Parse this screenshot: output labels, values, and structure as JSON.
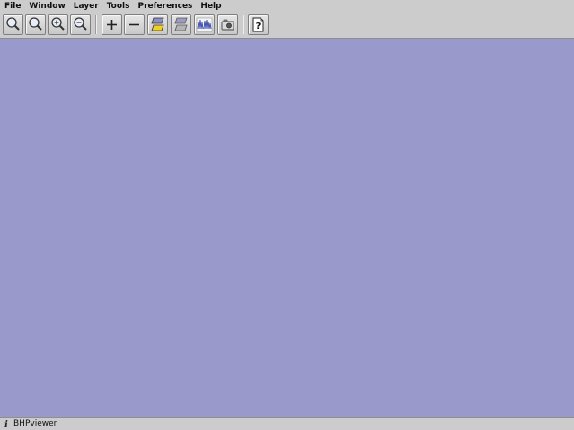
{
  "menu": {
    "items": [
      "File",
      "Window",
      "Layer",
      "Tools",
      "Preferences",
      "Help"
    ]
  },
  "toolbar": {
    "buttons": [
      {
        "name": "zoom-all-button",
        "icon": "magnifier-all-icon"
      },
      {
        "name": "zoom-button",
        "icon": "magnifier-icon"
      },
      {
        "name": "zoom-in-button",
        "icon": "magnifier-plus-icon"
      },
      {
        "name": "zoom-out-button",
        "icon": "magnifier-minus-icon"
      },
      {
        "name": "add-layer-button",
        "icon": "plus-icon"
      },
      {
        "name": "remove-layer-button",
        "icon": "minus-icon"
      },
      {
        "name": "layer-on-button",
        "icon": "layers-yellow-icon"
      },
      {
        "name": "layer-off-button",
        "icon": "layers-gray-icon"
      },
      {
        "name": "seismic-trace-button",
        "icon": "waveform-icon"
      },
      {
        "name": "snapshot-button",
        "icon": "camera-icon"
      },
      {
        "name": "help-button",
        "icon": "help-icon"
      }
    ]
  },
  "canvas": {
    "background": "#9999cc"
  },
  "status": {
    "text": "BHPviewer"
  }
}
